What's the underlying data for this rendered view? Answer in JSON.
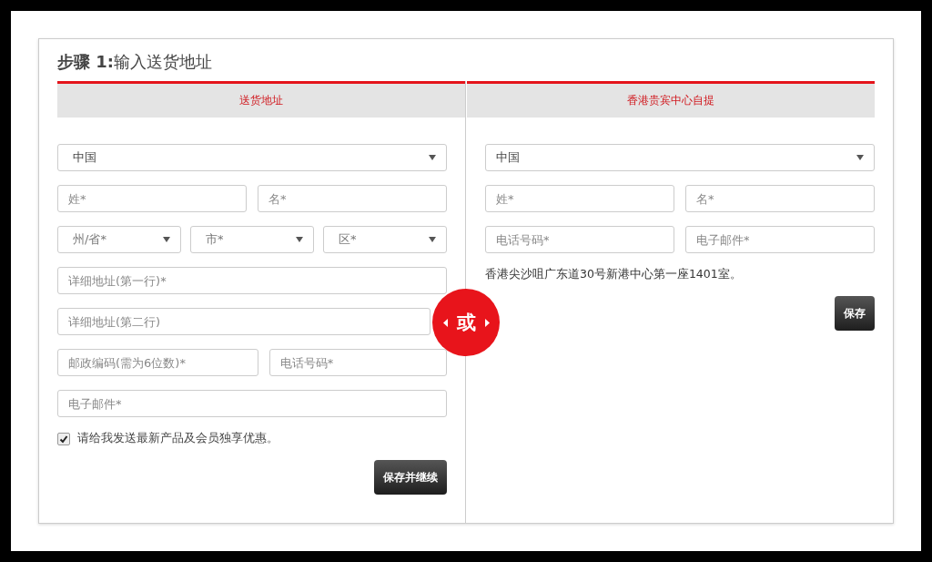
{
  "title": {
    "step": "步骤 1:",
    "text": "输入送货地址"
  },
  "tabs": [
    {
      "label": "送货地址",
      "selected": true
    },
    {
      "label": "香港贵宾中心自提",
      "selected": true
    }
  ],
  "divider_badge": {
    "label": "或"
  },
  "delivery_form": {
    "rows": [
      [
        {
          "kind": "select",
          "value": "中国"
        }
      ],
      [
        {
          "kind": "input",
          "placeholder": "姓*"
        },
        {
          "kind": "input",
          "placeholder": "名*"
        }
      ],
      [
        {
          "kind": "select",
          "placeholder": "州/省*"
        },
        {
          "kind": "select",
          "placeholder": "市*"
        },
        {
          "kind": "select",
          "placeholder": "区*"
        }
      ],
      [
        {
          "kind": "input",
          "placeholder": "详细地址(第一行)*"
        }
      ],
      [
        {
          "kind": "input",
          "placeholder": "详细地址(第二行)"
        }
      ],
      [
        {
          "kind": "input",
          "placeholder": "邮政编码(需为6位数)*"
        },
        {
          "kind": "input",
          "placeholder": "电话号码*"
        }
      ],
      [
        {
          "kind": "input",
          "placeholder": "电子邮件*"
        }
      ]
    ],
    "newsletter": {
      "label": "请给我发送最新产品及会员独享优惠。",
      "checked": true
    },
    "button": "保存并继续"
  },
  "pickup_form": {
    "rows": [
      [
        {
          "kind": "select",
          "value": "中国"
        }
      ],
      [
        {
          "kind": "input",
          "placeholder": "姓*"
        },
        {
          "kind": "input",
          "placeholder": "名*"
        }
      ],
      [
        {
          "kind": "input",
          "placeholder": "电话号码*"
        },
        {
          "kind": "input",
          "placeholder": "电子邮件*"
        }
      ]
    ],
    "address": "香港尖沙咀广东道30号新港中心第一座1401室。",
    "button": "保存"
  }
}
